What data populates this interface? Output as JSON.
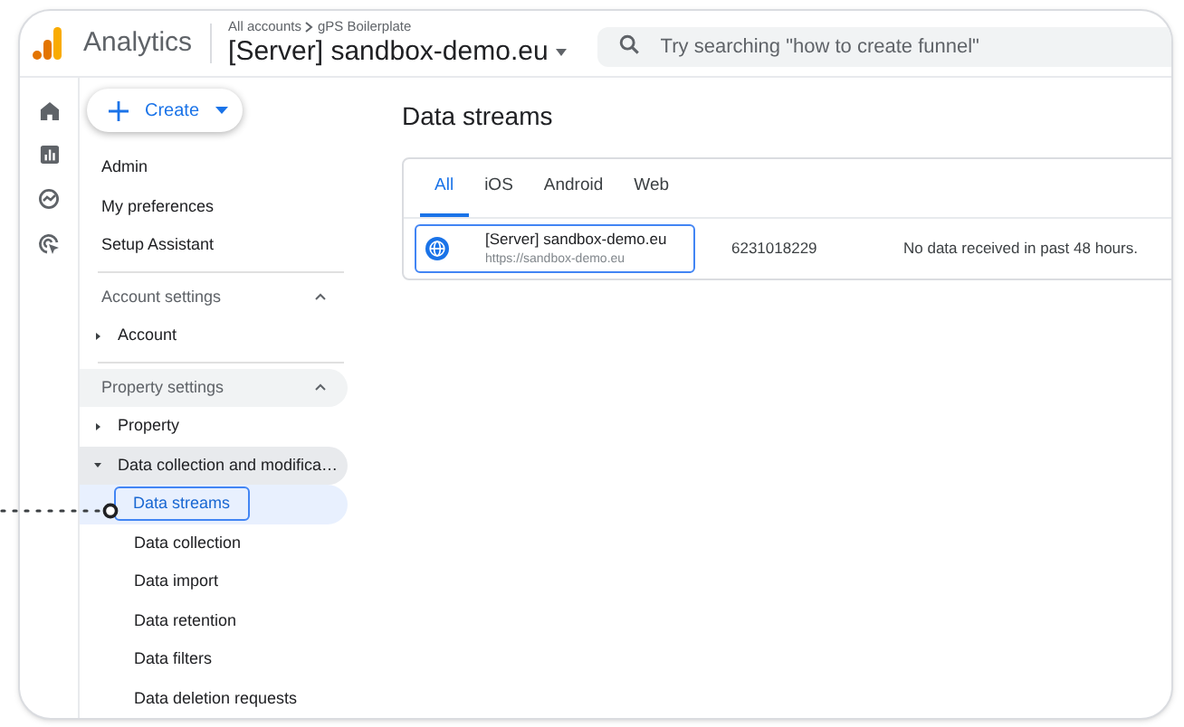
{
  "header": {
    "product": "Analytics",
    "breadcrumb": [
      "All accounts",
      "gPS Boilerplate"
    ],
    "property": "[Server] sandbox-demo.eu",
    "search": {
      "placeholder": "Try searching \"how to create funnel\""
    }
  },
  "create_button": {
    "label": "Create"
  },
  "nav": [
    {
      "kind": "link",
      "label": "Admin"
    },
    {
      "kind": "link",
      "label": "My preferences"
    },
    {
      "kind": "link",
      "label": "Setup Assistant"
    },
    {
      "kind": "section",
      "label": "Account settings",
      "expanded": true,
      "highlighted": false,
      "children": [
        {
          "label": "Account",
          "expanded": false,
          "highlighted": false
        }
      ]
    },
    {
      "kind": "section",
      "label": "Property settings",
      "expanded": true,
      "highlighted": true,
      "children": [
        {
          "label": "Property",
          "expanded": false,
          "highlighted": false
        },
        {
          "label": "Data collection and modifica…",
          "expanded": true,
          "highlighted": true,
          "children": [
            {
              "label": "Data streams",
              "selected": true
            },
            {
              "label": "Data collection",
              "selected": false
            },
            {
              "label": "Data import",
              "selected": false
            },
            {
              "label": "Data retention",
              "selected": false
            },
            {
              "label": "Data filters",
              "selected": false
            },
            {
              "label": "Data deletion requests",
              "selected": false
            }
          ]
        }
      ]
    }
  ],
  "main": {
    "title": "Data streams",
    "tabs": [
      {
        "label": "All",
        "selected": true
      },
      {
        "label": "iOS",
        "selected": false
      },
      {
        "label": "Android",
        "selected": false
      },
      {
        "label": "Web",
        "selected": false
      }
    ],
    "rows": [
      {
        "name": "[Server] sandbox-demo.eu",
        "url": "https://sandbox-demo.eu",
        "id": "6231018229",
        "status": "No data received in past 48 hours.",
        "selected": true
      }
    ]
  }
}
